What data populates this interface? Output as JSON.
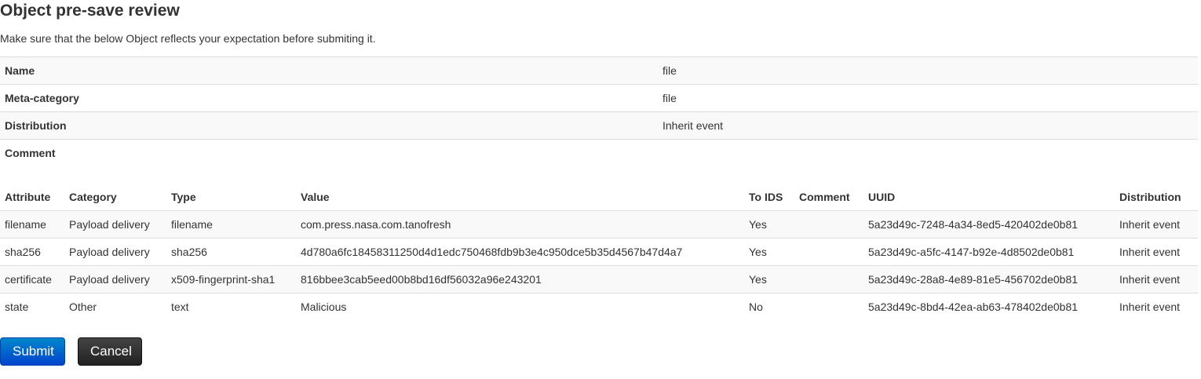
{
  "page": {
    "title": "Object pre-save review",
    "intro": "Make sure that the below Object reflects your expectation before submiting it."
  },
  "object": [
    {
      "key": "Name",
      "value": "file"
    },
    {
      "key": "Meta-category",
      "value": "file"
    },
    {
      "key": "Distribution",
      "value": "Inherit event"
    },
    {
      "key": "Comment",
      "value": ""
    }
  ],
  "attributes": {
    "headers": [
      "Attribute",
      "Category",
      "Type",
      "Value",
      "To IDS",
      "Comment",
      "UUID",
      "Distribution"
    ],
    "rows": [
      [
        "filename",
        "Payload delivery",
        "filename",
        "com.press.nasa.com.tanofresh",
        "Yes",
        "",
        "5a23d49c-7248-4a34-8ed5-420402de0b81",
        "Inherit event"
      ],
      [
        "sha256",
        "Payload delivery",
        "sha256",
        "4d780a6fc18458311250d4d1edc750468fdb9b3e4c950dce5b35d4567b47d4a7",
        "Yes",
        "",
        "5a23d49c-a5fc-4147-b92e-4d8502de0b81",
        "Inherit event"
      ],
      [
        "certificate",
        "Payload delivery",
        "x509-fingerprint-sha1",
        "816bbee3cab5eed00b8bd16df56032a96e243201",
        "Yes",
        "",
        "5a23d49c-28a8-4e89-81e5-456702de0b81",
        "Inherit event"
      ],
      [
        "state",
        "Other",
        "text",
        "Malicious",
        "No",
        "",
        "5a23d49c-8bd4-42ea-ab63-478402de0b81",
        "Inherit event"
      ]
    ]
  },
  "actions": {
    "submit_label": "Submit",
    "cancel_label": "Cancel"
  }
}
